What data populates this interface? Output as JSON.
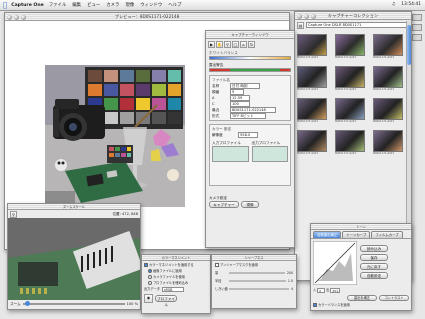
{
  "menubar": {
    "app_name": "Capture One",
    "items": [
      "ファイル",
      "編集",
      "ビュー",
      "カメラ",
      "現像",
      "ウィンドウ",
      "ヘルプ"
    ],
    "clock": "13:54:41"
  },
  "preview_window": {
    "title": "プレビュー：8D0S1171-022148"
  },
  "capture_panel": {
    "title": "キャプチャーウィンドウ",
    "subtitle": "ホワイトバランス",
    "labels": [
      "露出警告"
    ],
    "file_section": "ファイル名",
    "file_fields": [
      {
        "label": "名称",
        "value": "日付 時刻"
      },
      {
        "label": "順番",
        "value": "9"
      },
      {
        "label": "A",
        "value": "12.59"
      },
      {
        "label": "C",
        "value": "100"
      },
      {
        "label": "最近",
        "value": "8D0S1171-022148"
      },
      {
        "label": "形式",
        "value": "TIFF 8ビット"
      }
    ],
    "color_section": "カラー 設定",
    "color_rows": [
      {
        "label": "解像度",
        "value": "558.0"
      },
      {
        "label": "入力プロファイル",
        "value": ""
      },
      {
        "label": "出力プロファイル",
        "value": ""
      }
    ],
    "footer_label": "カメラ設定",
    "footer_buttons": [
      "キャプチャー",
      "現像"
    ]
  },
  "browser_window": {
    "title": "キャプチャーコレクション",
    "path": "Capture One DSLR 8D0S1171",
    "thumb_label": "8D0S1171-0221"
  },
  "zoom_window": {
    "title": "ズームスケール",
    "coords": "位置: 472, 848",
    "zoom_label": "ズーム",
    "zoom_value": "100 %"
  },
  "output_window": {
    "title": "カラーマネジメント",
    "checkbox": "カラーマネジメントを適用する",
    "options": [
      "画像ファイルに適用",
      "カメラファイルを使用",
      "プロファイルを埋め込み"
    ],
    "output_label": "出力データ",
    "output_value": "sRGB",
    "button": "プロファイル"
  },
  "sharpen_window": {
    "title": "シャープネス",
    "checkbox": "アンシャープマスクを適用",
    "rows": [
      {
        "label": "量",
        "value": "200"
      },
      {
        "label": "半径",
        "value": "1.0"
      },
      {
        "label": "しきい値",
        "value": "4"
      }
    ]
  },
  "curve_window": {
    "title": "トーン",
    "tabs": [
      "自動露出補正",
      "トーンカーブ",
      "フィルムカーブ"
    ],
    "buttons": [
      "読み込み",
      "保存",
      "元に戻す",
      "自動設定"
    ],
    "inputs": [
      {
        "label": "入",
        "value": "0"
      },
      {
        "label": "出",
        "value": "251"
      }
    ],
    "extra_buttons": [
      "露出を補正",
      "コントラスト"
    ],
    "checkbox": "カラーバランスを適用"
  },
  "colors": {
    "accent": "#4a86d9",
    "red": "#d2362f",
    "green": "#3aa04a"
  }
}
